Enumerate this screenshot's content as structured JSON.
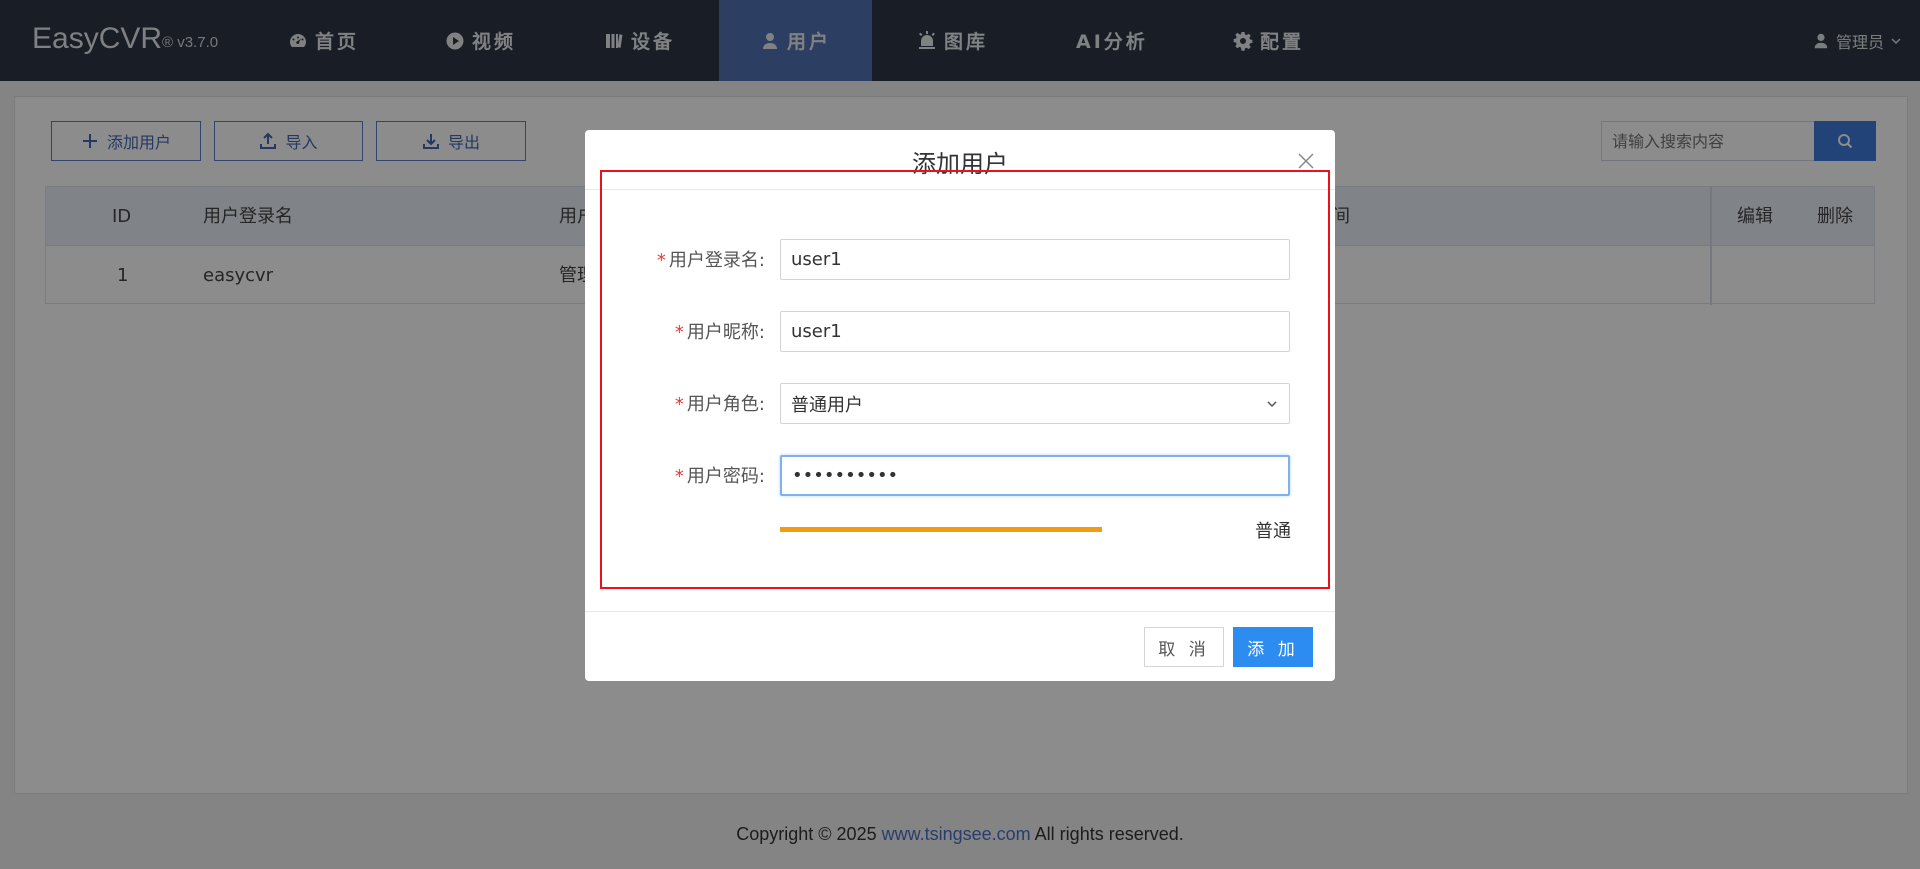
{
  "brand": {
    "name": "EasyCVR",
    "version": "® v3.7.0"
  },
  "nav": [
    {
      "label": "首页",
      "icon": "dashboard-icon"
    },
    {
      "label": "视频",
      "icon": "play-circle-icon"
    },
    {
      "label": "设备",
      "icon": "device-icon"
    },
    {
      "label": "用户",
      "icon": "user-icon"
    },
    {
      "label": "图库",
      "icon": "alarm-icon"
    },
    {
      "label": "AI分析",
      "icon": ""
    },
    {
      "label": "配置",
      "icon": "gear-icon"
    }
  ],
  "active_nav": "用户",
  "user_menu": {
    "label": "管理员"
  },
  "toolbar": {
    "add_label": "添加用户",
    "import_label": "导入",
    "export_label": "导出"
  },
  "search": {
    "placeholder": "请输入搜索内容"
  },
  "table": {
    "headers": {
      "id": "ID",
      "login": "用户登录名",
      "nick": "用户",
      "time": "间",
      "edit": "编辑",
      "delete": "删除"
    },
    "rows": [
      {
        "id": "1",
        "login": "easycvr",
        "role": "管理"
      }
    ]
  },
  "footer": {
    "prefix": "Copyright © 2025 ",
    "link": "www.tsingsee.com",
    "suffix": " All rights reserved."
  },
  "modal": {
    "title": "添加用户",
    "fields": [
      {
        "label": "用户登录名:",
        "value": "user1"
      },
      {
        "label": "用户昵称:",
        "value": "user1"
      },
      {
        "label": "用户角色:",
        "value": "普通用户"
      },
      {
        "label": "用户密码:",
        "value": "••••••••••"
      }
    ],
    "password_strength": {
      "level": 0.5,
      "label": "普通",
      "color": "#f39c12"
    },
    "cancel_label": "取 消",
    "submit_label": "添 加"
  },
  "colors": {
    "nav_bg": "#2f3646",
    "nav_active": "#5372b5",
    "primary": "#2d8cf0",
    "highlight": "#e8121b"
  }
}
